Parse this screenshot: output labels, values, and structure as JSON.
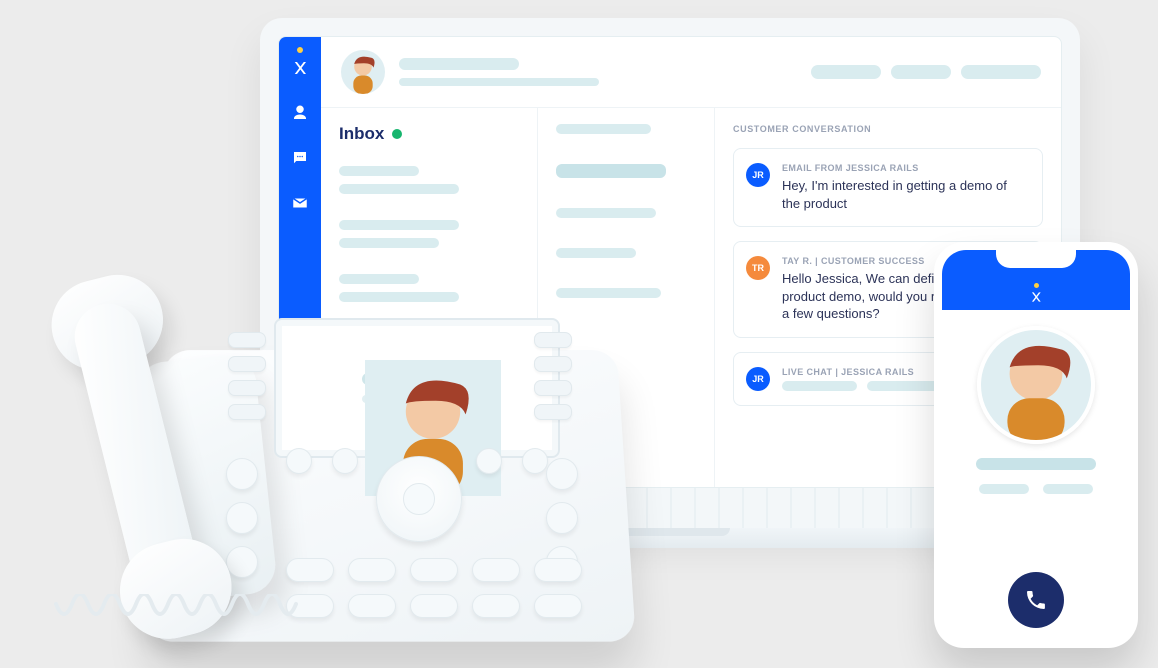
{
  "sidebar": {
    "items": [
      {
        "icon": "logo-x",
        "name": "brand-logo"
      },
      {
        "icon": "user",
        "name": "contacts-nav"
      },
      {
        "icon": "chat",
        "name": "messages-nav"
      },
      {
        "icon": "mail",
        "name": "email-nav"
      }
    ]
  },
  "inbox": {
    "title": "Inbox",
    "status": "online"
  },
  "conversation": {
    "section_label": "CUSTOMER CONVERSATION",
    "messages": [
      {
        "badge": "JR",
        "badge_color": "blue",
        "meta": "EMAIL FROM JESSICA RAILS",
        "text": "Hey, I'm interested in getting a demo of the product"
      },
      {
        "badge": "TR",
        "badge_color": "orange",
        "meta": "TAY R. | CUSTOMER SUCCESS",
        "text": "Hello Jessica, We can definately get you a product demo, would you mind answering a few questions?"
      },
      {
        "badge": "JR",
        "badge_color": "blue",
        "meta": "LIVE CHAT | JESSICA RAILS",
        "text": ""
      }
    ]
  },
  "phone": {
    "call_action": "call"
  },
  "colors": {
    "brand_blue": "#0a5cff",
    "brand_navy": "#1c2d6b",
    "accent_yellow": "#ffd042",
    "status_green": "#17b56e",
    "agent_orange": "#f58a3c"
  }
}
